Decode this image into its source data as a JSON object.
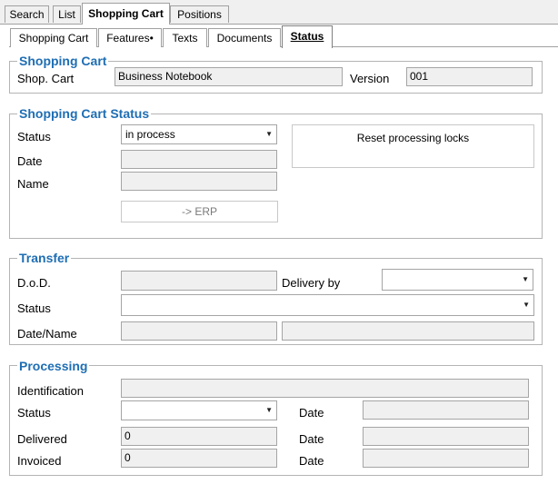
{
  "tabs": [
    "Search",
    "List",
    "Shopping Cart",
    "Positions"
  ],
  "subtabs": [
    "Shopping Cart",
    "Features•",
    "Texts",
    "Documents",
    "Status"
  ],
  "shopping_cart": {
    "title": "Shopping Cart",
    "shop_cart_label": "Shop. Cart",
    "shop_cart_value": "Business Notebook",
    "version_label": "Version",
    "version_value": "001"
  },
  "status_group": {
    "title": "Shopping Cart Status",
    "status_label": "Status",
    "status_value": "in process",
    "date_label": "Date",
    "date_value": "",
    "name_label": "Name",
    "name_value": "",
    "erp_button": "-> ERP",
    "reset_button": "Reset processing locks"
  },
  "transfer": {
    "title": "Transfer",
    "dod_label": "D.o.D.",
    "dod_value": "",
    "delivery_by_label": "Delivery by",
    "delivery_by_value": "",
    "status_label": "Status",
    "status_value": "",
    "datename_label": "Date/Name",
    "date_value": "",
    "name_value": ""
  },
  "processing": {
    "title": "Processing",
    "identification_label": "Identification",
    "identification_value": "",
    "status_label": "Status",
    "status_value": "",
    "delivered_label": "Delivered",
    "delivered_value": "0",
    "invoiced_label": "Invoiced",
    "invoiced_value": "0",
    "date_label": "Date",
    "status_date_value": "",
    "delivered_date_value": "",
    "invoiced_date_value": ""
  },
  "icons": {
    "dropdown": "chevron-down-icon"
  },
  "colors": {
    "group_title": "#1e6eb4",
    "field_bg": "#f0f0f0"
  }
}
